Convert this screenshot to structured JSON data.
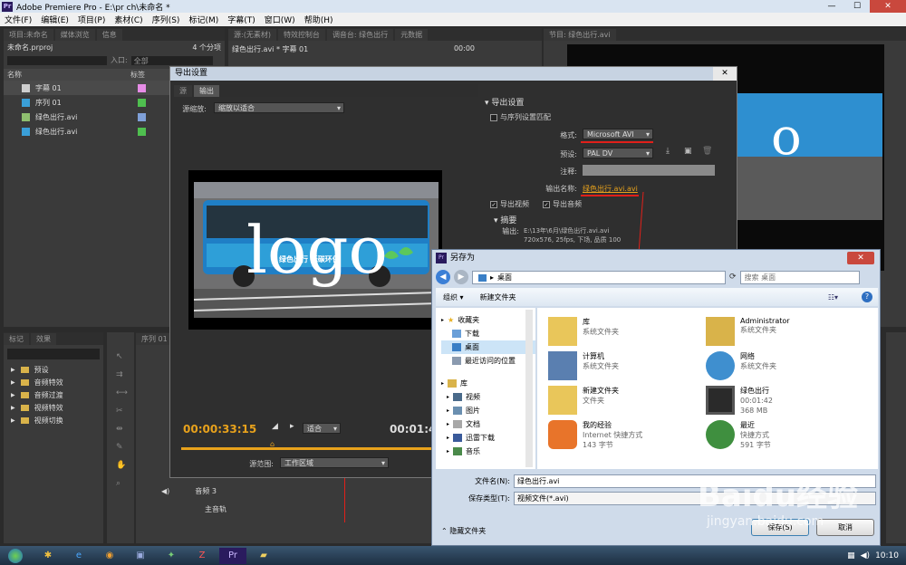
{
  "app": {
    "title": "Adobe Premiere Pro - E:\\pr ch\\未命名 *",
    "min": "—",
    "max": "☐",
    "close": "✕"
  },
  "menu": [
    "文件(F)",
    "编辑(E)",
    "项目(P)",
    "素材(C)",
    "序列(S)",
    "标记(M)",
    "字幕(T)",
    "窗口(W)",
    "帮助(H)"
  ],
  "project": {
    "tabs": [
      "项目:未命名",
      "媒体浏览",
      "信息"
    ],
    "name": "未命名.prproj",
    "count": "4 个分项",
    "entry_label": "入口:",
    "entry_value": "全部",
    "col_name": "名称",
    "col_label": "标签",
    "items": [
      {
        "name": "字幕 01",
        "color": "#e68ce6"
      },
      {
        "name": "序列 01",
        "color": "#4fbf4f"
      },
      {
        "name": "绿色出行.avi",
        "color": "#7fa0d8"
      },
      {
        "name": "绿色出行.avi",
        "color": "#4fbf4f"
      }
    ]
  },
  "effects": {
    "tabs": [
      "标记",
      "效果"
    ],
    "items": [
      "预设",
      "音频特效",
      "音频过渡",
      "视频特效",
      "视频切换"
    ]
  },
  "source": {
    "tabs": [
      "源:(无素材)",
      "特效控制台",
      "调音台: 绿色出行",
      "元数据"
    ],
    "clip": "绿色出行.avi * 字幕 01",
    "tc": "00:00"
  },
  "program": {
    "tab": "节目: 绿色出行.avi"
  },
  "timeline": {
    "tab": "序列 01",
    "track_audio3": "音频 3",
    "master": "主音轨"
  },
  "export": {
    "title": "导出设置",
    "tabs": [
      "源",
      "输出"
    ],
    "scale_label": "源缩放:",
    "scale_value": "缩放以适合",
    "section": "导出设置",
    "match_seq": "与序列设置匹配",
    "format_label": "格式:",
    "format_value": "Microsoft AVI",
    "preset_label": "预设:",
    "preset_value": "PAL DV",
    "notes_label": "注释:",
    "outname_label": "输出名称:",
    "outname_value": "绿色出行.avi.avi",
    "export_video": "导出视频",
    "export_audio": "导出音频",
    "summary": "摘要",
    "output_label": "输出:",
    "output_path": "E:\\13年\\6月\\绿色出行.avi.avi",
    "output_spec": "720x576, 25fps, 下场, 品质 100",
    "timecode": "00:00:33:15",
    "fit": "适合",
    "tc_right": "00:01:4",
    "range_label": "源范围:",
    "range_value": "工作区域",
    "logo_text": "logo",
    "bus_text": "绿色出行 低碳环保"
  },
  "saveas": {
    "title": "另存为",
    "path": "桌面",
    "search_placeholder": "搜索 桌面",
    "organize": "组织",
    "new_folder": "新建文件夹",
    "tree": [
      "收藏夹",
      "下载",
      "桌面",
      "最近访问的位置",
      "库",
      "视频",
      "图片",
      "文档",
      "迅雷下载",
      "音乐"
    ],
    "items": [
      {
        "name": "库",
        "sub1": "系统文件夹",
        "sub2": ""
      },
      {
        "name": "Administrator",
        "sub1": "系统文件夹",
        "sub2": ""
      },
      {
        "name": "计算机",
        "sub1": "系统文件夹",
        "sub2": ""
      },
      {
        "name": "网络",
        "sub1": "系统文件夹",
        "sub2": ""
      },
      {
        "name": "新建文件夹",
        "sub1": "文件夹",
        "sub2": ""
      },
      {
        "name": "绿色出行",
        "sub1": "00:01:42",
        "sub2": "368 MB"
      },
      {
        "name": "我的经验",
        "sub1": "Internet 快捷方式",
        "sub2": "143 字节"
      },
      {
        "name": "最近",
        "sub1": "快捷方式",
        "sub2": "591 字节"
      }
    ],
    "filename_label": "文件名(N):",
    "filename_value": "绿色出行.avi",
    "type_label": "保存类型(T):",
    "type_value": "视频文件(*.avi)",
    "hide_folders": "隐藏文件夹",
    "save": "保存(S)",
    "cancel": "取消"
  },
  "watermark": {
    "brand": "Baidu经验",
    "url": "jingyan.baidu.com"
  },
  "taskbar": {
    "time": "10:10"
  },
  "colors": {
    "accent_red": "#e0201a",
    "timecode": "#e8a21c"
  }
}
